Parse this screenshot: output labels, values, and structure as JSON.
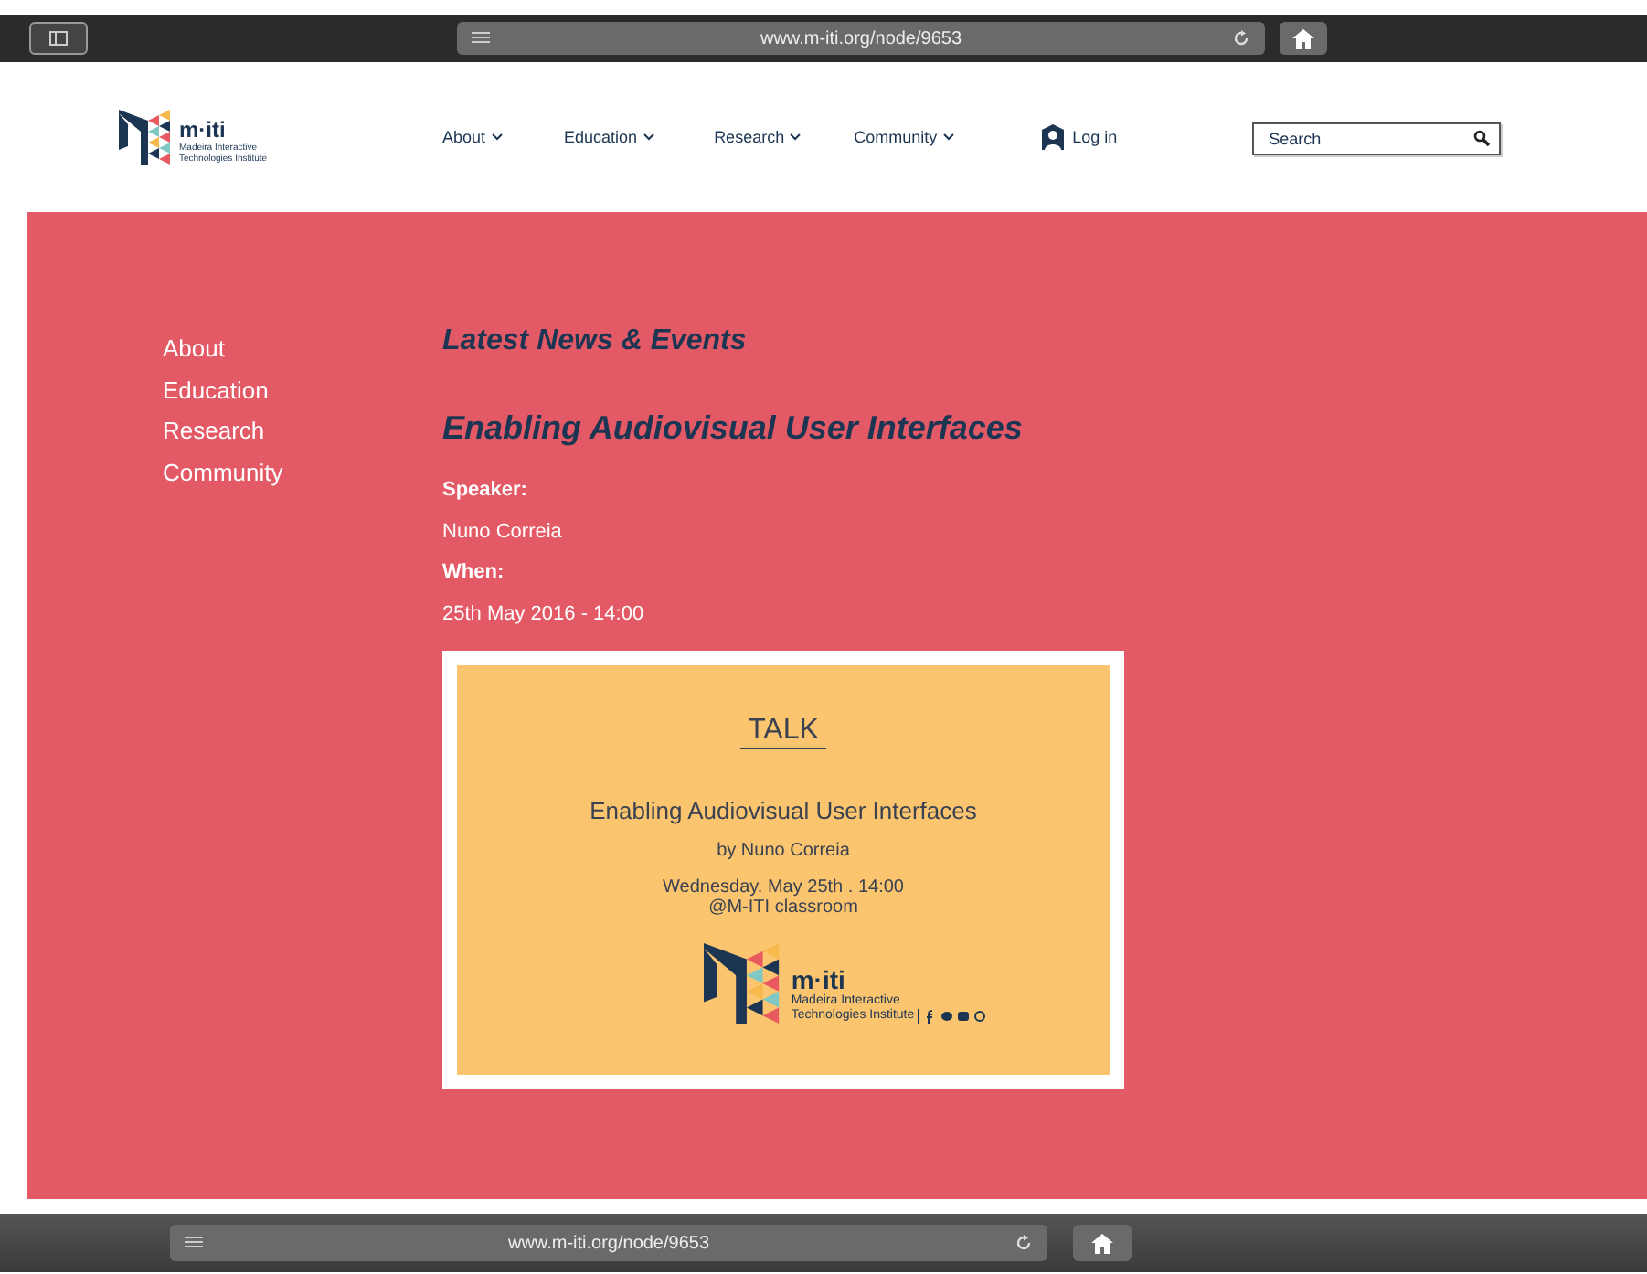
{
  "browser_top": {
    "url": "www.m-iti.org/node/9653"
  },
  "header": {
    "logo": {
      "name": "m·iti",
      "tagline_1": "Madeira Interactive",
      "tagline_2": "Technologies Institute"
    },
    "nav": [
      {
        "label": "About"
      },
      {
        "label": "Education"
      },
      {
        "label": "Research"
      },
      {
        "label": "Community"
      }
    ],
    "login": "Log in",
    "search": {
      "placeholder": "Search"
    }
  },
  "sidebar": {
    "items": [
      {
        "label": "About"
      },
      {
        "label": "Education"
      },
      {
        "label": "Research"
      },
      {
        "label": "Community"
      }
    ]
  },
  "content": {
    "section_title": "Latest News & Events",
    "title": "Enabling Audiovisual User Interfaces",
    "fields": [
      {
        "label": "Speaker:",
        "value": "Nuno Correia"
      },
      {
        "label": "When:",
        "value": "25th May 2016 - 14:00"
      }
    ],
    "poster": {
      "heading": "TALK",
      "title": "Enabling Audiovisual User Interfaces",
      "byline": "by Nuno Correia",
      "date": "Wednesday. May 25th . 14:00",
      "place": "@M-ITI classroom",
      "logo_name": "m·iti",
      "logo_tagline_1": "Madeira Interactive",
      "logo_tagline_2": "Technologies Institute"
    }
  },
  "browser_bottom": {
    "url": "www.m-iti.org/node/9653"
  }
}
